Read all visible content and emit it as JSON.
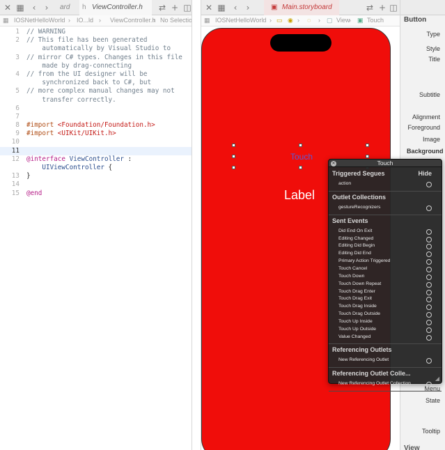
{
  "left_pane": {
    "tabs": [
      {
        "label": "ard",
        "active": false
      },
      {
        "label": "ViewController.h",
        "active": true
      }
    ],
    "jumpbar": [
      "IOSNetHelloWorld",
      "IO...ld",
      "ViewController.h",
      "No Selection"
    ],
    "code_lines": [
      {
        "n": "1",
        "text": "// WARNING",
        "kind": "comment"
      },
      {
        "n": "2",
        "text": "// This file has been generated",
        "kind": "comment"
      },
      {
        "n": "",
        "text": "    automatically by Visual Studio to",
        "kind": "comment"
      },
      {
        "n": "3",
        "text": "// mirror C# types. Changes in this file",
        "kind": "comment"
      },
      {
        "n": "",
        "text": "    made by drag-connecting",
        "kind": "comment"
      },
      {
        "n": "4",
        "text": "// from the UI designer will be",
        "kind": "comment"
      },
      {
        "n": "",
        "text": "    synchronized back to C#, but",
        "kind": "comment"
      },
      {
        "n": "5",
        "text": "// more complex manual changes may not",
        "kind": "comment"
      },
      {
        "n": "",
        "text": "    transfer correctly.",
        "kind": "comment"
      },
      {
        "n": "6",
        "text": "",
        "kind": "plain"
      },
      {
        "n": "7",
        "text": "",
        "kind": "plain"
      },
      {
        "n": "8",
        "kind": "import",
        "dir": "#import",
        "arg": "<Foundation/Foundation.h>"
      },
      {
        "n": "9",
        "kind": "import",
        "dir": "#import",
        "arg": "<UIKit/UIKit.h>"
      },
      {
        "n": "10",
        "text": "",
        "kind": "plain"
      },
      {
        "n": "11",
        "text": "",
        "kind": "plain",
        "current": true
      },
      {
        "n": "12",
        "kind": "interface",
        "kw": "@interface",
        "name": "ViewController",
        "rest": " :"
      },
      {
        "n": "",
        "kind": "typeline",
        "type": "    UIViewController",
        "rest": " {"
      },
      {
        "n": "13",
        "text": "}",
        "kind": "plain"
      },
      {
        "n": "14",
        "text": "",
        "kind": "plain"
      },
      {
        "n": "15",
        "text": "@end",
        "kind": "keyword"
      }
    ]
  },
  "canvas_pane": {
    "tab_label": "Main.storyboard",
    "jumpbar": [
      "IOSNetHelloWorld",
      "View",
      "Touch"
    ],
    "phone_color": "#f00d0a",
    "button_title": "Touch",
    "label_text": "Label"
  },
  "inspector": {
    "title": "Button",
    "rows": [
      "Type",
      "Style",
      "Title",
      "Subtitle",
      "Alignment",
      "Foreground",
      "Image",
      "Background Co",
      "Menu",
      "State",
      "Tooltip"
    ],
    "section_view": "View"
  },
  "connections_hud": {
    "title": "Touch",
    "sections": {
      "triggered_segues": "Triggered Segues",
      "hide": "Hide",
      "outlet_collections": "Outlet Collections",
      "sent_events": "Sent Events",
      "referencing_outlets": "Referencing Outlets",
      "referencing_outlet_collections": "Referencing Outlet Colle..."
    },
    "segue_items": [
      "action"
    ],
    "outlet_collection_items": [
      "gestureRecognizers"
    ],
    "sent_event_items": [
      "Did End On Exit",
      "Editing Changed",
      "Editing Did Begin",
      "Editing Did End",
      "Primary Action Triggered",
      "Touch Cancel",
      "Touch Down",
      "Touch Down Repeat",
      "Touch Drag Enter",
      "Touch Drag Exit",
      "Touch Drag Inside",
      "Touch Drag Outside",
      "Touch Up Inside",
      "Touch Up Outside",
      "Value Changed"
    ],
    "referencing_outlet_items": [
      "New Referencing Outlet"
    ],
    "referencing_collection_items": [
      "New Referencing Outlet Collection"
    ]
  },
  "icons": {
    "close": "close-icon",
    "grid": "grid-icon",
    "back": "chevron-left-icon",
    "forward": "chevron-right-icon",
    "swap": "swap-icon",
    "split": "split-editor-icon",
    "file": "file-h-icon"
  }
}
